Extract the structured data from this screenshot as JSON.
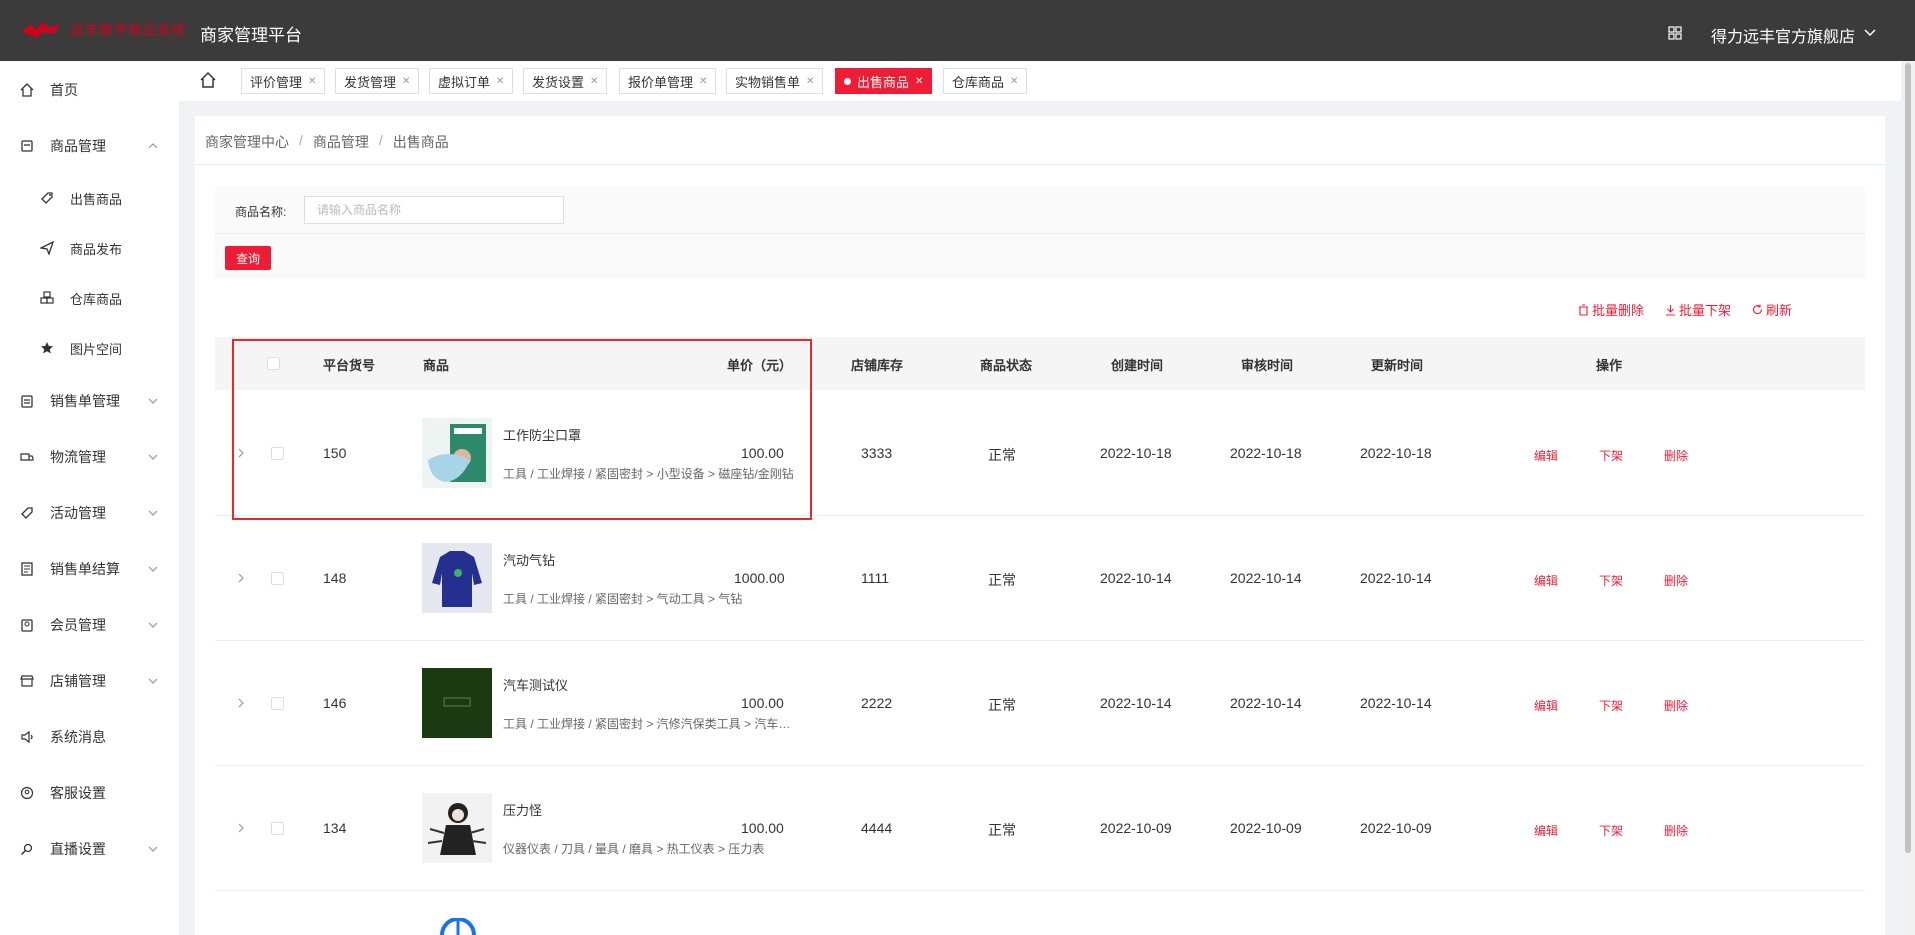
{
  "header": {
    "logo_text": "远丰数字商业系统",
    "app_title": "商家管理平台",
    "store_name": "得力远丰官方旗舰店"
  },
  "sidebar": {
    "items": [
      {
        "label": "首页",
        "icon": "home-icon"
      },
      {
        "label": "商品管理",
        "icon": "goods-icon",
        "expanded": true
      },
      {
        "label": "出售商品",
        "icon": "tag-icon",
        "sub": true
      },
      {
        "label": "商品发布",
        "icon": "send-icon",
        "sub": true
      },
      {
        "label": "仓库商品",
        "icon": "boxes-icon",
        "sub": true
      },
      {
        "label": "图片空间",
        "icon": "star-icon",
        "sub": true
      },
      {
        "label": "销售单管理",
        "icon": "clipboard-icon"
      },
      {
        "label": "物流管理",
        "icon": "truck-icon"
      },
      {
        "label": "活动管理",
        "icon": "tag-icon"
      },
      {
        "label": "销售单结算",
        "icon": "ledger-icon"
      },
      {
        "label": "会员管理",
        "icon": "member-icon"
      },
      {
        "label": "店铺管理",
        "icon": "shop-icon"
      },
      {
        "label": "系统消息",
        "icon": "speaker-icon"
      },
      {
        "label": "客服设置",
        "icon": "service-icon"
      },
      {
        "label": "直播设置",
        "icon": "live-icon"
      }
    ]
  },
  "tabs": [
    {
      "label": "评价管理"
    },
    {
      "label": "发货管理"
    },
    {
      "label": "虚拟订单"
    },
    {
      "label": "发货设置"
    },
    {
      "label": "报价单管理"
    },
    {
      "label": "实物销售单"
    },
    {
      "label": "出售商品",
      "active": true
    },
    {
      "label": "仓库商品"
    }
  ],
  "breadcrumb": [
    "商家管理中心",
    "商品管理",
    "出售商品"
  ],
  "filter": {
    "label": "商品名称:",
    "placeholder": "请输入商品名称",
    "search_label": "查询"
  },
  "actions": {
    "batch_delete": "批量删除",
    "batch_offshelf": "批量下架",
    "refresh": "刷新"
  },
  "table": {
    "headers": {
      "sku": "平台货号",
      "product": "商品",
      "price": "单价（元）",
      "stock": "店铺库存",
      "status": "商品状态",
      "created": "创建时间",
      "reviewed": "审核时间",
      "updated": "更新时间",
      "ops": "操作"
    },
    "op_labels": {
      "edit": "编辑",
      "offshelf": "下架",
      "delete": "删除"
    },
    "rows": [
      {
        "sku": "150",
        "name": "工作防尘口罩",
        "category": "工具 / 工业焊接 / 紧固密封 > 小型设备 > 磁座钻/金刚钻",
        "price": "100.00",
        "stock": "3333",
        "status": "正常",
        "created": "2022-10-18",
        "reviewed": "2022-10-18",
        "updated": "2022-10-18"
      },
      {
        "sku": "148",
        "name": "汽动气钻",
        "category": "工具 / 工业焊接 / 紧固密封 > 气动工具 > 气钻",
        "price": "1000.00",
        "stock": "1111",
        "status": "正常",
        "created": "2022-10-14",
        "reviewed": "2022-10-14",
        "updated": "2022-10-14"
      },
      {
        "sku": "146",
        "name": "汽车测试仪",
        "category": "工具 / 工业焊接 / 紧固密封 > 汽修汽保类工具 > 汽车测试仪",
        "price": "100.00",
        "stock": "2222",
        "status": "正常",
        "created": "2022-10-14",
        "reviewed": "2022-10-14",
        "updated": "2022-10-14"
      },
      {
        "sku": "134",
        "name": "压力怪",
        "category": "仪器仪表 / 刀具 / 量具 / 磨具 > 热工仪表 > 压力表",
        "price": "100.00",
        "stock": "4444",
        "status": "正常",
        "created": "2022-10-09",
        "reviewed": "2022-10-09",
        "updated": "2022-10-09"
      }
    ]
  },
  "colors": {
    "accent": "#ee1d37",
    "topbar": "#3b3b3b",
    "highlight": "#e8282b"
  }
}
